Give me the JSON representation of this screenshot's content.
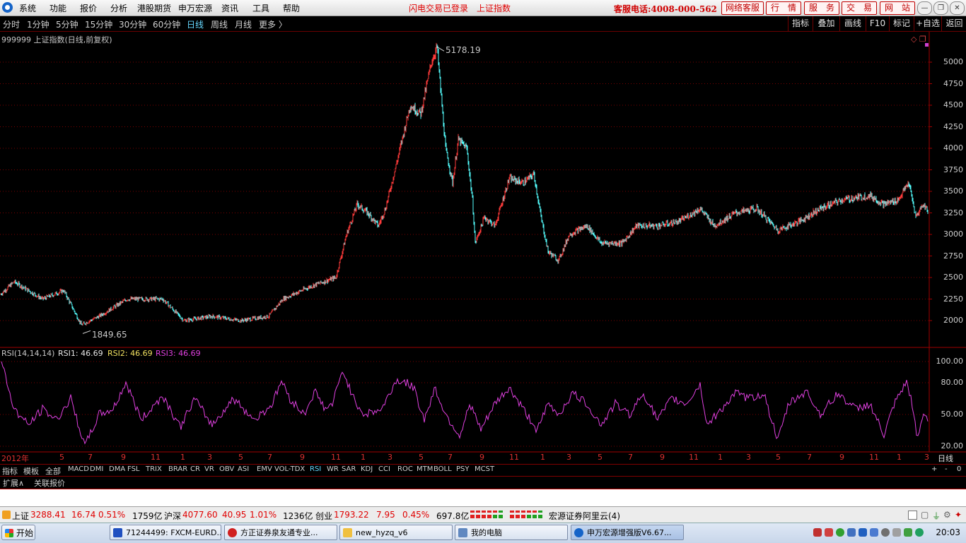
{
  "menu": {
    "items": [
      "系统",
      "功能",
      "报价",
      "分析",
      "港股期货",
      "申万宏源",
      "资讯",
      "工具",
      "帮助"
    ],
    "flash_status": "闪电交易已登录",
    "flash_index": "上证指数",
    "hotline": "客服电话:4008-000-562",
    "buttons": [
      "网络客服",
      "行　情",
      "服　务",
      "交　易",
      "网　站"
    ]
  },
  "periods": {
    "items": [
      "分时",
      "1分钟",
      "5分钟",
      "15分钟",
      "30分钟",
      "60分钟",
      "日线",
      "周线",
      "月线",
      "更多 〉"
    ],
    "active": "日线"
  },
  "right_tools": [
    "指标",
    "叠加",
    "画线",
    "F10",
    "标记",
    "+自选",
    "返回"
  ],
  "main_chart": {
    "title": "999999 上证指数(日线,前复权)",
    "high_label": "5178.19",
    "low_label": "1849.65",
    "y_ticks": [
      "5000",
      "4750",
      "4500",
      "4250",
      "4000",
      "3750",
      "3500",
      "3250",
      "3000",
      "2750",
      "2500",
      "2250",
      "2000"
    ]
  },
  "rsi": {
    "title": "RSI(14,14,14)",
    "rsi1": "RSI1: 46.69",
    "rsi2": "RSI2: 46.69",
    "rsi3": "RSI3: 46.69",
    "y_ticks": [
      "100.00",
      "80.00",
      "50.00",
      "20.00"
    ]
  },
  "x_axis": {
    "first": "2012年",
    "labels": [
      "5",
      "7",
      "9",
      "11",
      "1",
      "3",
      "5",
      "7",
      "9",
      "11",
      "1",
      "3",
      "5",
      "7",
      "9",
      "11",
      "1",
      "3",
      "5",
      "7",
      "9",
      "11",
      "1",
      "3",
      "5",
      "7",
      "9",
      "11",
      "1",
      "3"
    ],
    "right": "日线"
  },
  "indicator_tabs": {
    "items": [
      "指标",
      "模板",
      "全部",
      "MACD",
      "DMI",
      "DMA",
      "FSL",
      "TRIX",
      "BRAR",
      "CR",
      "VR",
      "OBV",
      "ASI",
      "EMV",
      "VOL-TDX",
      "RSI",
      "WR",
      "SAR",
      "KDJ",
      "CCI",
      "ROC",
      "MTM",
      "BOLL",
      "PSY",
      "MCST"
    ],
    "active": "RSI"
  },
  "ext_tabs": [
    "扩展∧",
    "关联报价"
  ],
  "status": {
    "sh_label": "上证",
    "sh_price": "3288.41",
    "sh_change": "16.74",
    "sh_pct": "0.51%",
    "sh_amount": "1759亿",
    "hs_label": "沪深",
    "hs_price": "4077.60",
    "hs_change": "40.95",
    "hs_pct": "1.01%",
    "hs_amount": "1236亿",
    "cy_label": "创业",
    "cy_price": "1793.22",
    "cy_change": "7.95",
    "cy_pct": "0.45%",
    "cy_amount": "697.8亿",
    "server": "宏源证券阿里云(4)"
  },
  "taskbar": {
    "start": "开始",
    "tasks": [
      "71244499: FXCM-EURD...",
      "方正证券泉友通专业...",
      "new_hyzq_v6",
      "我的电脑",
      "申万宏源增强版V6.67..."
    ],
    "clock": "20:03"
  },
  "chart_data": {
    "type": "candlestick+line",
    "main_series": {
      "name": "上证指数",
      "y_range": [
        1800,
        5250
      ],
      "anchors": [
        [
          0,
          2300
        ],
        [
          20,
          2450
        ],
        [
          60,
          2250
        ],
        [
          90,
          2350
        ],
        [
          115,
          1950
        ],
        [
          140,
          2050
        ],
        [
          180,
          2250
        ],
        [
          230,
          2250
        ],
        [
          260,
          2000
        ],
        [
          300,
          2050
        ],
        [
          340,
          2000
        ],
        [
          380,
          2050
        ],
        [
          400,
          2250
        ],
        [
          440,
          2400
        ],
        [
          475,
          2500
        ],
        [
          490,
          3000
        ],
        [
          505,
          3350
        ],
        [
          520,
          3250
        ],
        [
          535,
          3100
        ],
        [
          545,
          3300
        ],
        [
          560,
          3800
        ],
        [
          580,
          4500
        ],
        [
          595,
          4400
        ],
        [
          610,
          5000
        ],
        [
          618,
          5178
        ],
        [
          630,
          4000
        ],
        [
          640,
          3600
        ],
        [
          648,
          4100
        ],
        [
          660,
          4000
        ],
        [
          668,
          3400
        ],
        [
          672,
          2900
        ],
        [
          685,
          3200
        ],
        [
          700,
          3100
        ],
        [
          720,
          3650
        ],
        [
          740,
          3600
        ],
        [
          755,
          3700
        ],
        [
          765,
          3200
        ],
        [
          775,
          2800
        ],
        [
          790,
          2700
        ],
        [
          805,
          3000
        ],
        [
          830,
          3100
        ],
        [
          850,
          2900
        ],
        [
          880,
          2900
        ],
        [
          900,
          3100
        ],
        [
          930,
          3100
        ],
        [
          960,
          3150
        ],
        [
          990,
          3300
        ],
        [
          1010,
          3100
        ],
        [
          1040,
          3250
        ],
        [
          1070,
          3300
        ],
        [
          1100,
          3050
        ],
        [
          1130,
          3150
        ],
        [
          1160,
          3300
        ],
        [
          1190,
          3400
        ],
        [
          1230,
          3450
        ],
        [
          1250,
          3350
        ],
        [
          1270,
          3400
        ],
        [
          1285,
          3600
        ],
        [
          1295,
          3200
        ],
        [
          1305,
          3350
        ],
        [
          1312,
          3280
        ]
      ]
    },
    "rsi_series": {
      "name": "RSI",
      "y_range": [
        15,
        100
      ],
      "last": 46.69,
      "anchors": [
        [
          2,
          100
        ],
        [
          20,
          55
        ],
        [
          40,
          40
        ],
        [
          60,
          55
        ],
        [
          80,
          45
        ],
        [
          100,
          65
        ],
        [
          120,
          20
        ],
        [
          140,
          50
        ],
        [
          160,
          55
        ],
        [
          178,
          80
        ],
        [
          200,
          45
        ],
        [
          230,
          68
        ],
        [
          255,
          38
        ],
        [
          275,
          65
        ],
        [
          300,
          40
        ],
        [
          330,
          65
        ],
        [
          360,
          45
        ],
        [
          385,
          60
        ],
        [
          398,
          82
        ],
        [
          410,
          65
        ],
        [
          430,
          50
        ],
        [
          445,
          72
        ],
        [
          460,
          55
        ],
        [
          470,
          60
        ],
        [
          485,
          92
        ],
        [
          500,
          65
        ],
        [
          515,
          50
        ],
        [
          540,
          55
        ],
        [
          560,
          82
        ],
        [
          575,
          80
        ],
        [
          585,
          75
        ],
        [
          600,
          45
        ],
        [
          615,
          75
        ],
        [
          630,
          50
        ],
        [
          650,
          30
        ],
        [
          665,
          60
        ],
        [
          680,
          35
        ],
        [
          700,
          60
        ],
        [
          720,
          75
        ],
        [
          740,
          55
        ],
        [
          760,
          35
        ],
        [
          775,
          60
        ],
        [
          790,
          50
        ],
        [
          810,
          70
        ],
        [
          830,
          60
        ],
        [
          850,
          40
        ],
        [
          870,
          60
        ],
        [
          890,
          50
        ],
        [
          910,
          70
        ],
        [
          930,
          45
        ],
        [
          950,
          65
        ],
        [
          970,
          60
        ],
        [
          990,
          78
        ],
        [
          1000,
          40
        ],
        [
          1020,
          55
        ],
        [
          1040,
          70
        ],
        [
          1060,
          65
        ],
        [
          1080,
          70
        ],
        [
          1100,
          25
        ],
        [
          1115,
          60
        ],
        [
          1140,
          72
        ],
        [
          1160,
          50
        ],
        [
          1185,
          70
        ],
        [
          1210,
          55
        ],
        [
          1230,
          60
        ],
        [
          1250,
          30
        ],
        [
          1265,
          60
        ],
        [
          1282,
          80
        ],
        [
          1290,
          60
        ],
        [
          1297,
          25
        ],
        [
          1305,
          50
        ],
        [
          1312,
          47
        ]
      ]
    }
  }
}
